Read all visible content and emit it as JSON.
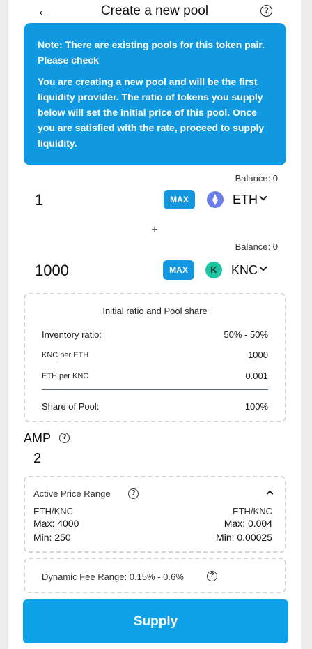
{
  "header": {
    "back_icon": "arrow-left-icon",
    "title": "Create a new pool",
    "help_icon": "question-circle-icon"
  },
  "notice": {
    "line1": "Note: There are existing pools for this token pair. Please check",
    "line2": "You are creating a new pool and will be the first liquidity provider. The ratio of tokens you supply below will set the initial price of this pool. Once you are satisfied with the rate, proceed to supply liquidity.",
    "background": "#1098e0"
  },
  "token_a": {
    "balance": "Balance: 0",
    "amount": "1",
    "max_label": "MAX",
    "symbol": "ETH",
    "icon": "ethereum-icon"
  },
  "plus": "+",
  "token_b": {
    "balance": "Balance: 0",
    "amount": "1000",
    "max_label": "MAX",
    "symbol": "KNC",
    "icon": "kyber-network-icon"
  },
  "ratio": {
    "title": "Initial ratio and Pool share",
    "inventory_label": "Inventory ratio:",
    "inventory_value": "50% - 50%",
    "knc_per_eth_label": "KNC per ETH",
    "knc_per_eth_value": "1000",
    "eth_per_knc_label": "ETH per KNC",
    "eth_per_knc_value": "0.001",
    "share_label": "Share of Pool:",
    "share_value": "100%"
  },
  "amp": {
    "label": "AMP",
    "value": "2"
  },
  "price_range": {
    "title": "Active Price Range",
    "left_pair": "ETH/KNC",
    "left_max": "Max: 4000",
    "left_min": "Min: 250",
    "right_pair": "ETH/KNC",
    "right_max": "Max: 0.004",
    "right_min": "Min: 0.00025"
  },
  "fee": {
    "label": "Dynamic Fee Range: 0.15% - 0.6%"
  },
  "supply_label": "Supply",
  "colors": {
    "accent": "#1597e0",
    "supply": "#0fa1e8",
    "knc": "#1cc5a2",
    "eth": "#6b7ee8"
  }
}
